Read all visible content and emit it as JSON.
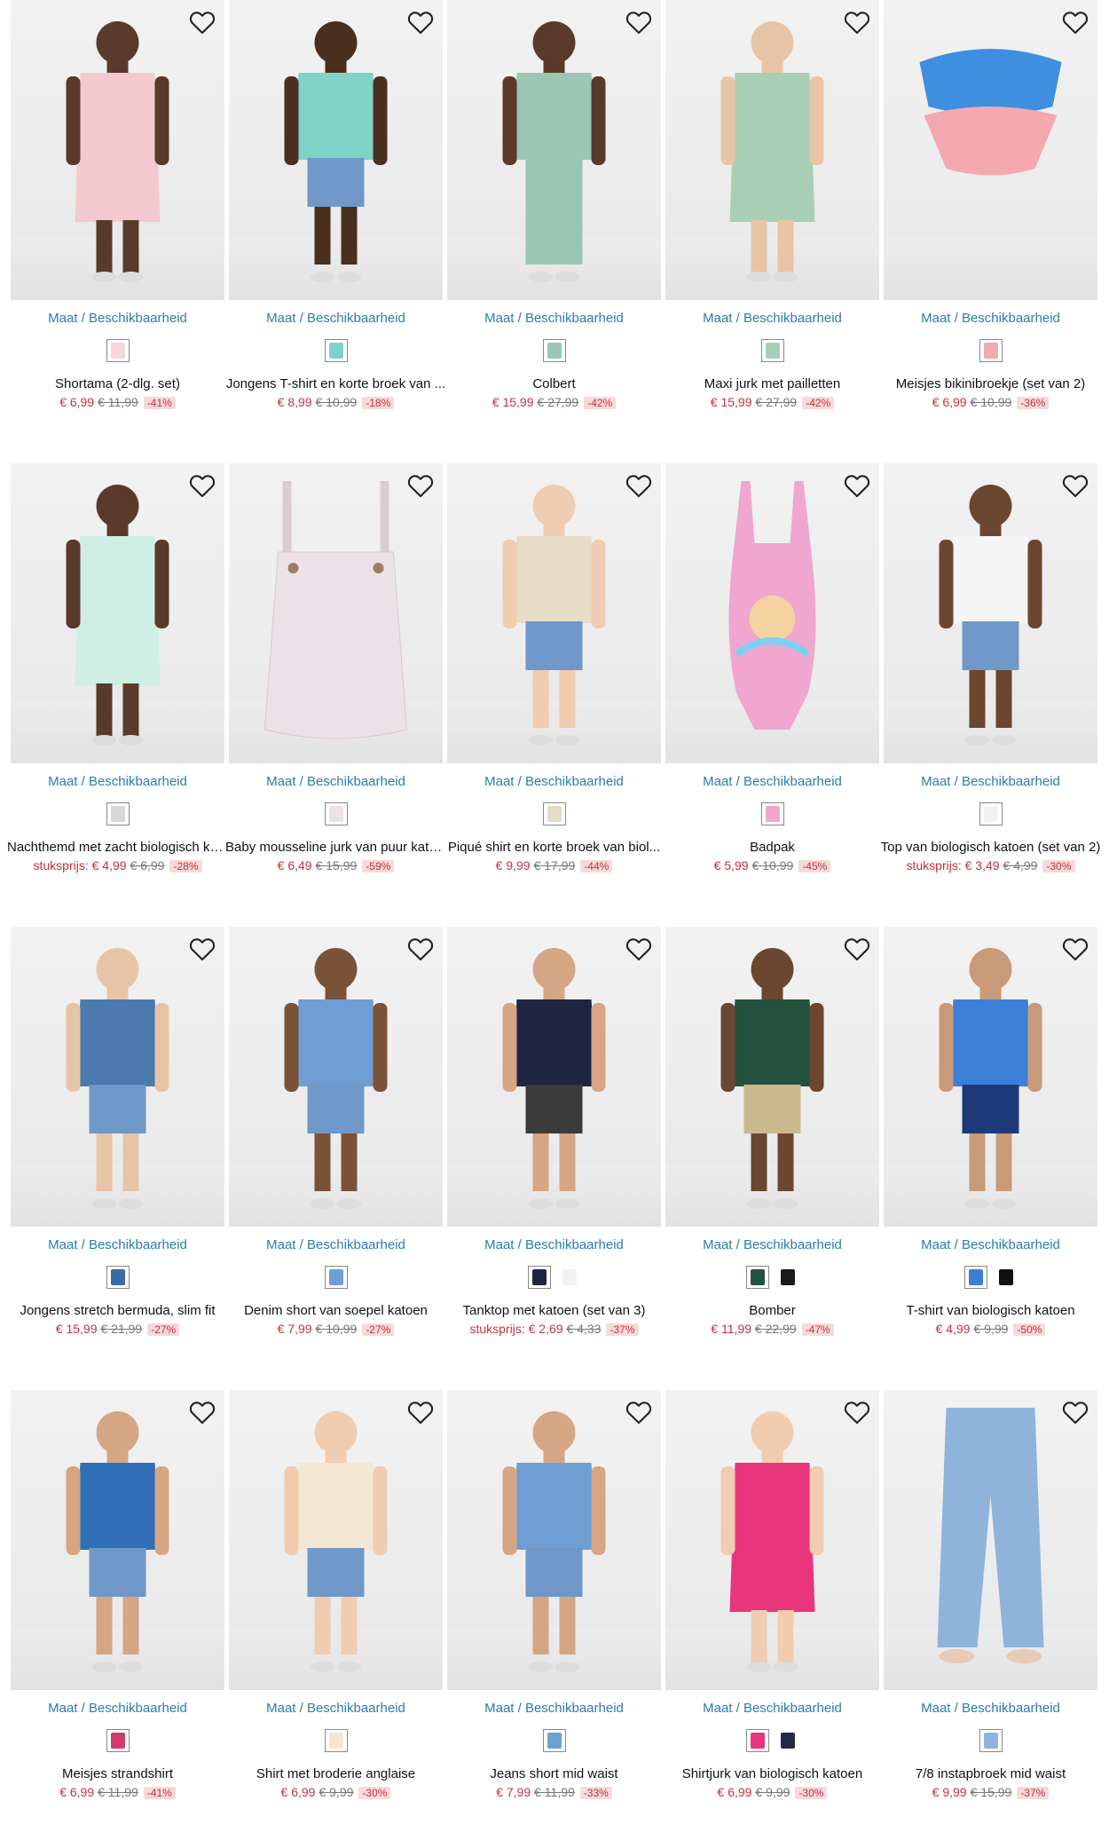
{
  "common": {
    "maat_label": "Maat / Beschikbaarheid",
    "wishlist_icon": "heart-outline-icon"
  },
  "colors": {
    "link": "#2b7bb2",
    "price": "#c8313a",
    "discount_bg": "#f6dada"
  },
  "products": [
    {
      "name": "Shortama (2-dlg. set)",
      "price": "€ 6,99",
      "old": "€ 11,99",
      "disc": "-41%",
      "swatches": [
        "#f6d6d6"
      ],
      "bg": "#f3c9cf",
      "skin": "#5a3a2a",
      "kind": "girl-set"
    },
    {
      "name": "Jongens T-shirt en korte broek van ...",
      "price": "€ 8,99",
      "old": "€ 10,99",
      "disc": "-18%",
      "swatches": [
        "#7fd3c6"
      ],
      "bg": "#7fd3c6",
      "skin": "#4a2e1e",
      "kind": "boy-run"
    },
    {
      "name": "Colbert",
      "price": "€ 15,99",
      "old": "€ 27,99",
      "disc": "-42%",
      "swatches": [
        "#9cc6b4"
      ],
      "bg": "#9cc6b4",
      "skin": "#5a3a2a",
      "kind": "suit"
    },
    {
      "name": "Maxi jurk met pailletten",
      "price": "€ 15,99",
      "old": "€ 27,99",
      "disc": "-42%",
      "swatches": [
        "#a8cfb6"
      ],
      "bg": "#a8cfb6",
      "skin": "#e8c4a6",
      "kind": "maxi"
    },
    {
      "name": "Meisjes bikinibroekje (set van 2)",
      "price": "€ 6,99",
      "old": "€ 10,99",
      "disc": "-36%",
      "swatches": [
        "#f4a8b0"
      ],
      "bg": "#f4a8b0",
      "skin": "#3f8fe0",
      "kind": "bikini"
    },
    {
      "name": "Nachthemd met zacht biologisch ka...",
      "price": "stuksprijs: € 4,99",
      "old": "€ 6,99",
      "disc": "-28%",
      "swatches": [
        "#d8d8d8"
      ],
      "bg": "#cfeee4",
      "skin": "#5a3a2a",
      "kind": "nightdress"
    },
    {
      "name": "Baby mousseline jurk van puur katoen",
      "price": "€ 6,49",
      "old": "€ 15,99",
      "disc": "-59%",
      "swatches": [
        "#ece1e6"
      ],
      "bg": "#ece1e6",
      "skin": "#ece1e6",
      "kind": "muslin"
    },
    {
      "name": "Piqué shirt en korte broek van biol...",
      "price": "€ 9,99",
      "old": "€ 17,99",
      "disc": "-44%",
      "swatches": [
        "#e7dcc5"
      ],
      "bg": "#e7dcc5",
      "skin": "#f0ccb0",
      "kind": "palm"
    },
    {
      "name": "Badpak",
      "price": "€ 5,99",
      "old": "€ 10,99",
      "disc": "-45%",
      "swatches": [
        "#f0a6cf"
      ],
      "bg": "#f0a6cf",
      "skin": "#f0a6cf",
      "kind": "swimsuit"
    },
    {
      "name": "Top van biologisch katoen (set van 2)",
      "price": "stuksprijs: € 3,49",
      "old": "€ 4,99",
      "disc": "-30%",
      "swatches": [
        "#f2f2f2"
      ],
      "bg": "#f5f5f5",
      "skin": "#6b4630",
      "kind": "top-dots"
    },
    {
      "name": "Jongens stretch bermuda, slim fit",
      "price": "€ 15,99",
      "old": "€ 21,99",
      "disc": "-27%",
      "swatches": [
        "#3a6aa8"
      ],
      "bg": "#4c79b0",
      "skin": "#e8c4a6",
      "kind": "bermuda"
    },
    {
      "name": "Denim short van soepel katoen",
      "price": "€ 7,99",
      "old": "€ 10,99",
      "disc": "-27%",
      "swatches": [
        "#6e9ed3"
      ],
      "bg": "#6e9ed3",
      "skin": "#7a5238",
      "kind": "denim-short"
    },
    {
      "name": "Tanktop met katoen (set van 3)",
      "price": "stuksprijs: € 2,69",
      "old": "€ 4,33",
      "disc": "-37%",
      "swatches": [
        "#1e2540",
        "#f2f2f2"
      ],
      "bg": "#1e2540",
      "skin": "#d6a584",
      "kind": "tank"
    },
    {
      "name": "Bomber",
      "price": "€ 11,99",
      "old": "€ 22,99",
      "disc": "-47%",
      "swatches": [
        "#25513f",
        "#1a1a1a"
      ],
      "bg": "#25513f",
      "skin": "#6b4630",
      "kind": "bomber"
    },
    {
      "name": "T-shirt van biologisch katoen",
      "price": "€ 4,99",
      "old": "€ 9,99",
      "disc": "-50%",
      "swatches": [
        "#3c7fd8",
        "#111111"
      ],
      "bg": "#3c7fd8",
      "skin": "#c99a78",
      "kind": "tshirt"
    },
    {
      "name": "Meisjes strandshirt",
      "price": "€ 6,99",
      "old": "€ 11,99",
      "disc": "-41%",
      "swatches": [
        "#d23b6a"
      ],
      "bg": "#2f6fb8",
      "skin": "#d6a584",
      "kind": "beach"
    },
    {
      "name": "Shirt met broderie anglaise",
      "price": "€ 6,99",
      "old": "€ 9,99",
      "disc": "-30%",
      "swatches": [
        "#f3e7d2"
      ],
      "bg": "#f3e7d2",
      "skin": "#f0ccb0",
      "kind": "broderie"
    },
    {
      "name": "Jeans short mid waist",
      "price": "€ 7,99",
      "old": "€ 11,99",
      "disc": "-33%",
      "swatches": [
        "#6f9fd2"
      ],
      "bg": "#6f9fd2",
      "skin": "#d6a584",
      "kind": "jeans-short"
    },
    {
      "name": "Shirtjurk van biologisch katoen",
      "price": "€ 6,99",
      "old": "€ 9,99",
      "disc": "-30%",
      "swatches": [
        "#e8357c",
        "#1f2a45"
      ],
      "bg": "#e8357c",
      "skin": "#f0ccb0",
      "kind": "shirtdress"
    },
    {
      "name": "7/8 instapbroek mid waist",
      "price": "€ 9,99",
      "old": "€ 15,99",
      "disc": "-37%",
      "swatches": [
        "#8fb4dc"
      ],
      "bg": "#8fb4dc",
      "skin": "#f0ccb0",
      "kind": "pants"
    }
  ]
}
